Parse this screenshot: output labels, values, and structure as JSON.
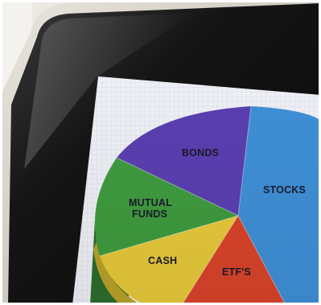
{
  "photo": {
    "subject": "tablet-showing-investment-pie-chart",
    "pie_slices": [
      {
        "label": "STOCKS",
        "color": "#3f8fd6"
      },
      {
        "label": "BONDS",
        "color": "#5a3fb0"
      },
      {
        "label": "MUTUAL FUNDS",
        "label_lines": [
          "MUTUAL",
          "FUNDS"
        ],
        "color": "#3f9a3f"
      },
      {
        "label": "CASH",
        "color": "#e6c83a"
      },
      {
        "label": "ETF'S",
        "color": "#d8432a"
      }
    ],
    "colors": {
      "bezel": "#1a1a1a",
      "tablet_frame": "#d9d6cf",
      "screen_paper": "#eef0f6",
      "background": "#efece6"
    }
  }
}
